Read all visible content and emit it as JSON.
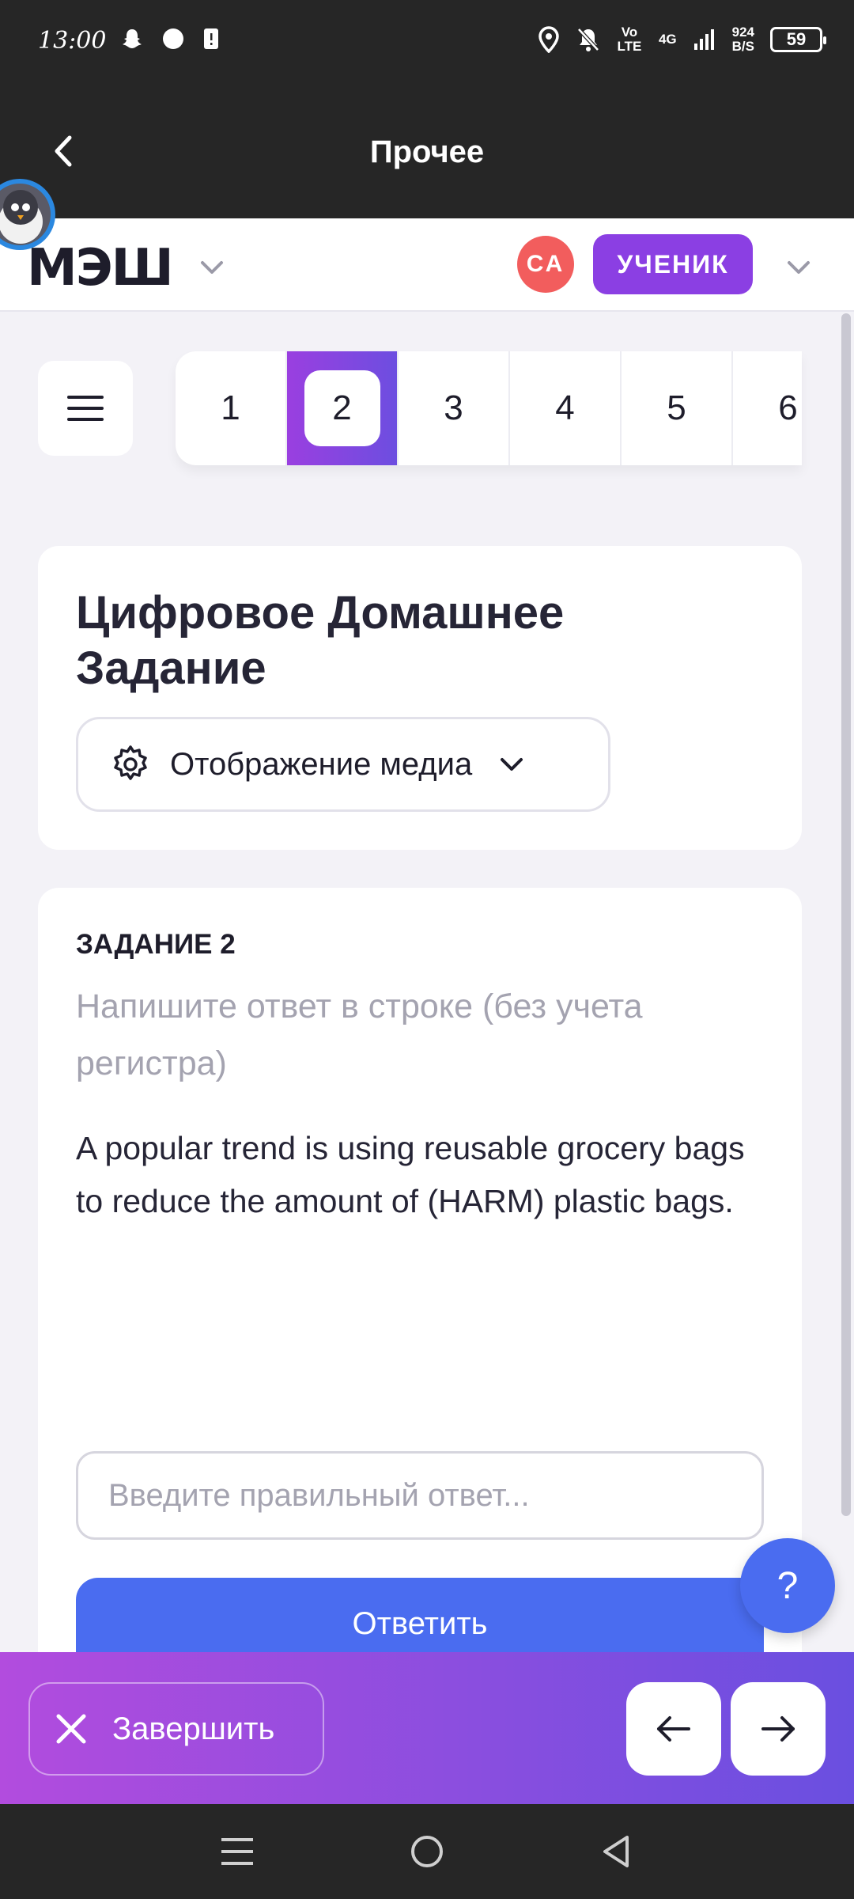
{
  "status_bar": {
    "time": "13:00",
    "network": "Vo LTE",
    "signal": "4G",
    "speed_value": "924",
    "speed_unit": "B/S",
    "battery": "59"
  },
  "app_bar": {
    "title": "Прочее"
  },
  "header": {
    "logo": "МЭШ",
    "avatar_initials": "СА",
    "role": "УЧЕНИК"
  },
  "pagination": {
    "pages": [
      "1",
      "2",
      "3",
      "4",
      "5",
      "6"
    ],
    "active": "2"
  },
  "homework": {
    "title": "Цифровое Домашнее Задание",
    "media_button": "Отображение медиа"
  },
  "task": {
    "number": "ЗАДАНИЕ 2",
    "hint": "Напишите ответ в строке (без учета регистра)",
    "text": "A popular trend is using reusable grocery bags to reduce the amount of (HARM) plastic bags.",
    "answer_placeholder": "Введите правильный ответ...",
    "submit": "Ответить",
    "help": "?"
  },
  "action_bar": {
    "finish": "Завершить"
  },
  "colors": {
    "accent_purple": "#8b3fe3",
    "accent_blue": "#4a6cf0",
    "avatar_red": "#f25d5d"
  }
}
